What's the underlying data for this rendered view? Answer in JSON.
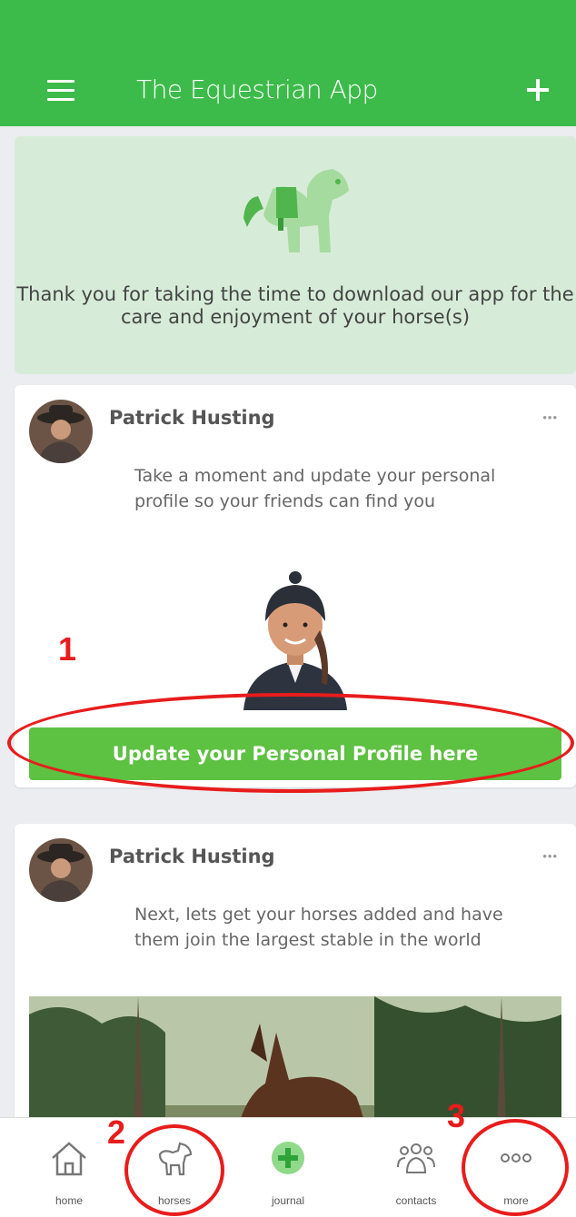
{
  "header": {
    "title": "The Equestrian App"
  },
  "welcome": {
    "message": "Thank you for taking the time to download our app for the care and enjoyment of your horse(s)"
  },
  "posts": [
    {
      "author": "Patrick Husting",
      "text": "Take a moment and update your personal profile so your friends can find you",
      "button": "Update your Personal Profile here"
    },
    {
      "author": "Patrick Husting",
      "text": "Next, lets get your horses added and have them join the largest stable in the world"
    }
  ],
  "nav": [
    {
      "label": "home",
      "icon": "home-icon"
    },
    {
      "label": "horses",
      "icon": "horse-icon"
    },
    {
      "label": "journal",
      "icon": "plus-circle-icon"
    },
    {
      "label": "contacts",
      "icon": "people-icon"
    },
    {
      "label": "more",
      "icon": "dots-icon"
    }
  ],
  "annotations": [
    "1",
    "2",
    "3"
  ],
  "colors": {
    "primary_green": "#3dbb4a",
    "button_green": "#5dc142",
    "welcome_bg": "#d7ecd8",
    "annotation_red": "#e81c1c"
  }
}
